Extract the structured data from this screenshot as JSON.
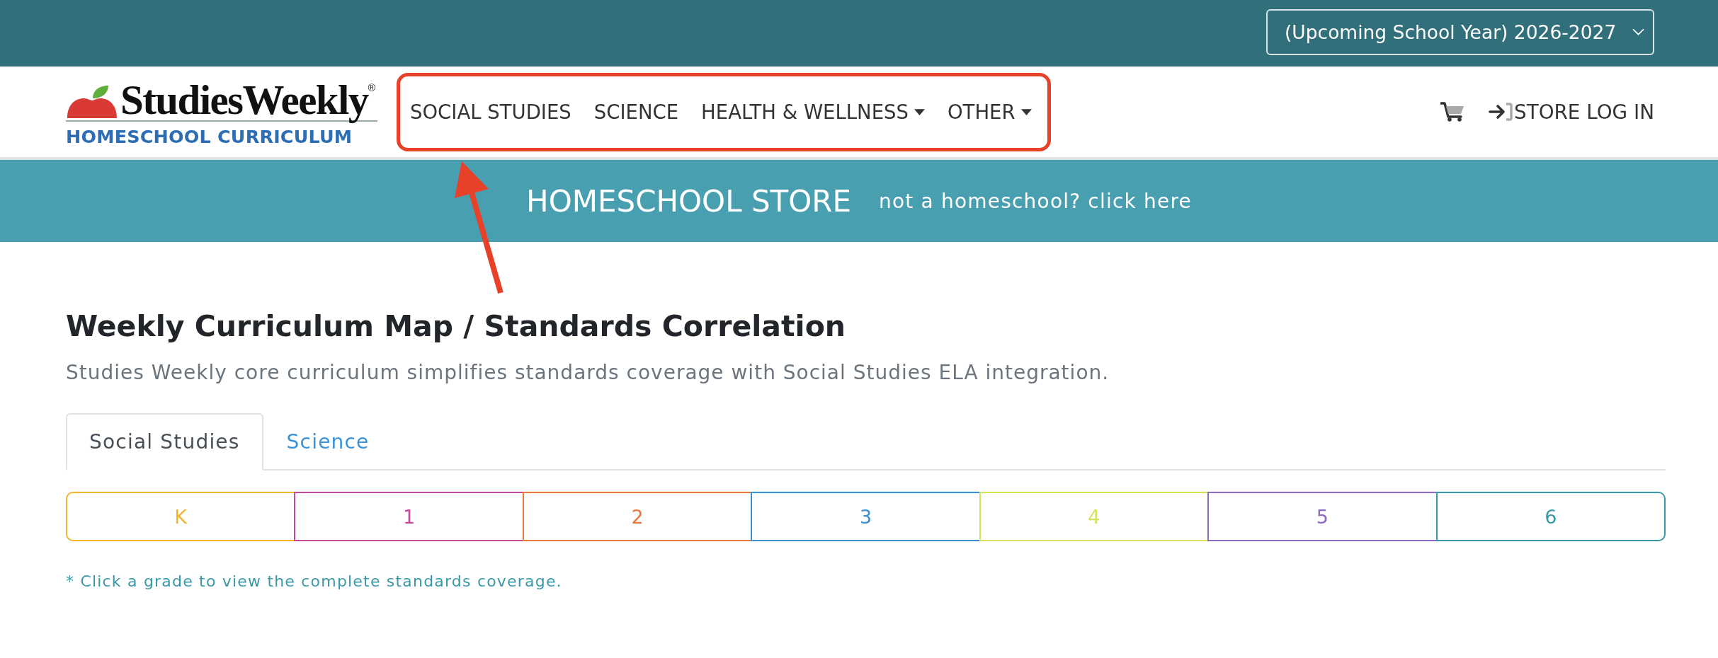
{
  "top_bar": {
    "year_select": {
      "value": "(Upcoming School Year) 2026-2027"
    }
  },
  "logo": {
    "wordmark": "StudiesWeekly",
    "registered": "®",
    "tagline": "HOMESCHOOL CURRICULUM"
  },
  "nav": {
    "items": [
      {
        "label": "SOCIAL STUDIES",
        "kind": "link"
      },
      {
        "label": "SCIENCE",
        "kind": "link"
      },
      {
        "label": "HEALTH & WELLNESS",
        "kind": "dropdown"
      },
      {
        "label": "OTHER",
        "kind": "dropdown"
      }
    ]
  },
  "header_actions": {
    "login": "STORE LOG IN"
  },
  "banner": {
    "title": "HOMESCHOOL STORE",
    "link": "not a homeschool? click here"
  },
  "page": {
    "heading": "Weekly Curriculum Map / Standards Correlation",
    "subtitle": "Studies Weekly core curriculum simplifies standards coverage with Social Studies ELA integration."
  },
  "tabs": [
    {
      "label": "Social Studies",
      "selected": true
    },
    {
      "label": "Science",
      "selected": false
    }
  ],
  "grades": [
    {
      "label": "K",
      "color": "#f2b52c"
    },
    {
      "label": "1",
      "color": "#c8489e"
    },
    {
      "label": "2",
      "color": "#e8773c"
    },
    {
      "label": "3",
      "color": "#3d90cf"
    },
    {
      "label": "4",
      "color": "#d5e25a"
    },
    {
      "label": "5",
      "color": "#8b6bc1"
    },
    {
      "label": "6",
      "color": "#3998a5"
    }
  ],
  "footnote": "* Click a grade to view the complete standards coverage."
}
